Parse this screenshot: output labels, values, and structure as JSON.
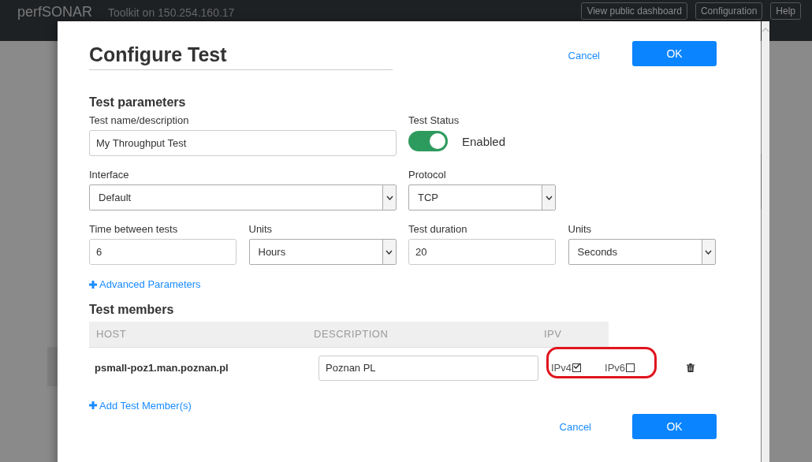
{
  "header": {
    "logo": "perfSONAR",
    "subtitle": "Toolkit on 150.254.160.17",
    "buttons": [
      "View public dashboard",
      "Configuration",
      "Help"
    ]
  },
  "dialog": {
    "title": "Configure Test",
    "cancel": "Cancel",
    "ok": "OK",
    "parameters": {
      "heading": "Test parameters",
      "name": {
        "label": "Test name/description",
        "value": "My Throughput Test"
      },
      "status": {
        "label": "Test Status",
        "on": true,
        "text": "Enabled"
      },
      "interface": {
        "label": "Interface",
        "value": "Default"
      },
      "protocol": {
        "label": "Protocol",
        "value": "TCP"
      },
      "interval": {
        "label": "Time between tests",
        "value": "6"
      },
      "interval_units": {
        "label": "Units",
        "value": "Hours"
      },
      "duration": {
        "label": "Test duration",
        "value": "20"
      },
      "duration_units": {
        "label": "Units",
        "value": "Seconds"
      },
      "advanced": "Advanced Parameters"
    },
    "members": {
      "heading": "Test members",
      "columns": [
        "HOST",
        "DESCRIPTION",
        "IPV"
      ],
      "rows": [
        {
          "host": "psmall-poz1.man.poznan.pl",
          "description": "Poznan PL",
          "ipv4": {
            "label": "IPv4",
            "checked": true
          },
          "ipv6": {
            "label": "IPv6",
            "checked": false
          },
          "highlighted": true
        }
      ],
      "add": "Add Test Member(s)"
    },
    "footer": {
      "cancel": "Cancel",
      "ok": "OK"
    }
  }
}
